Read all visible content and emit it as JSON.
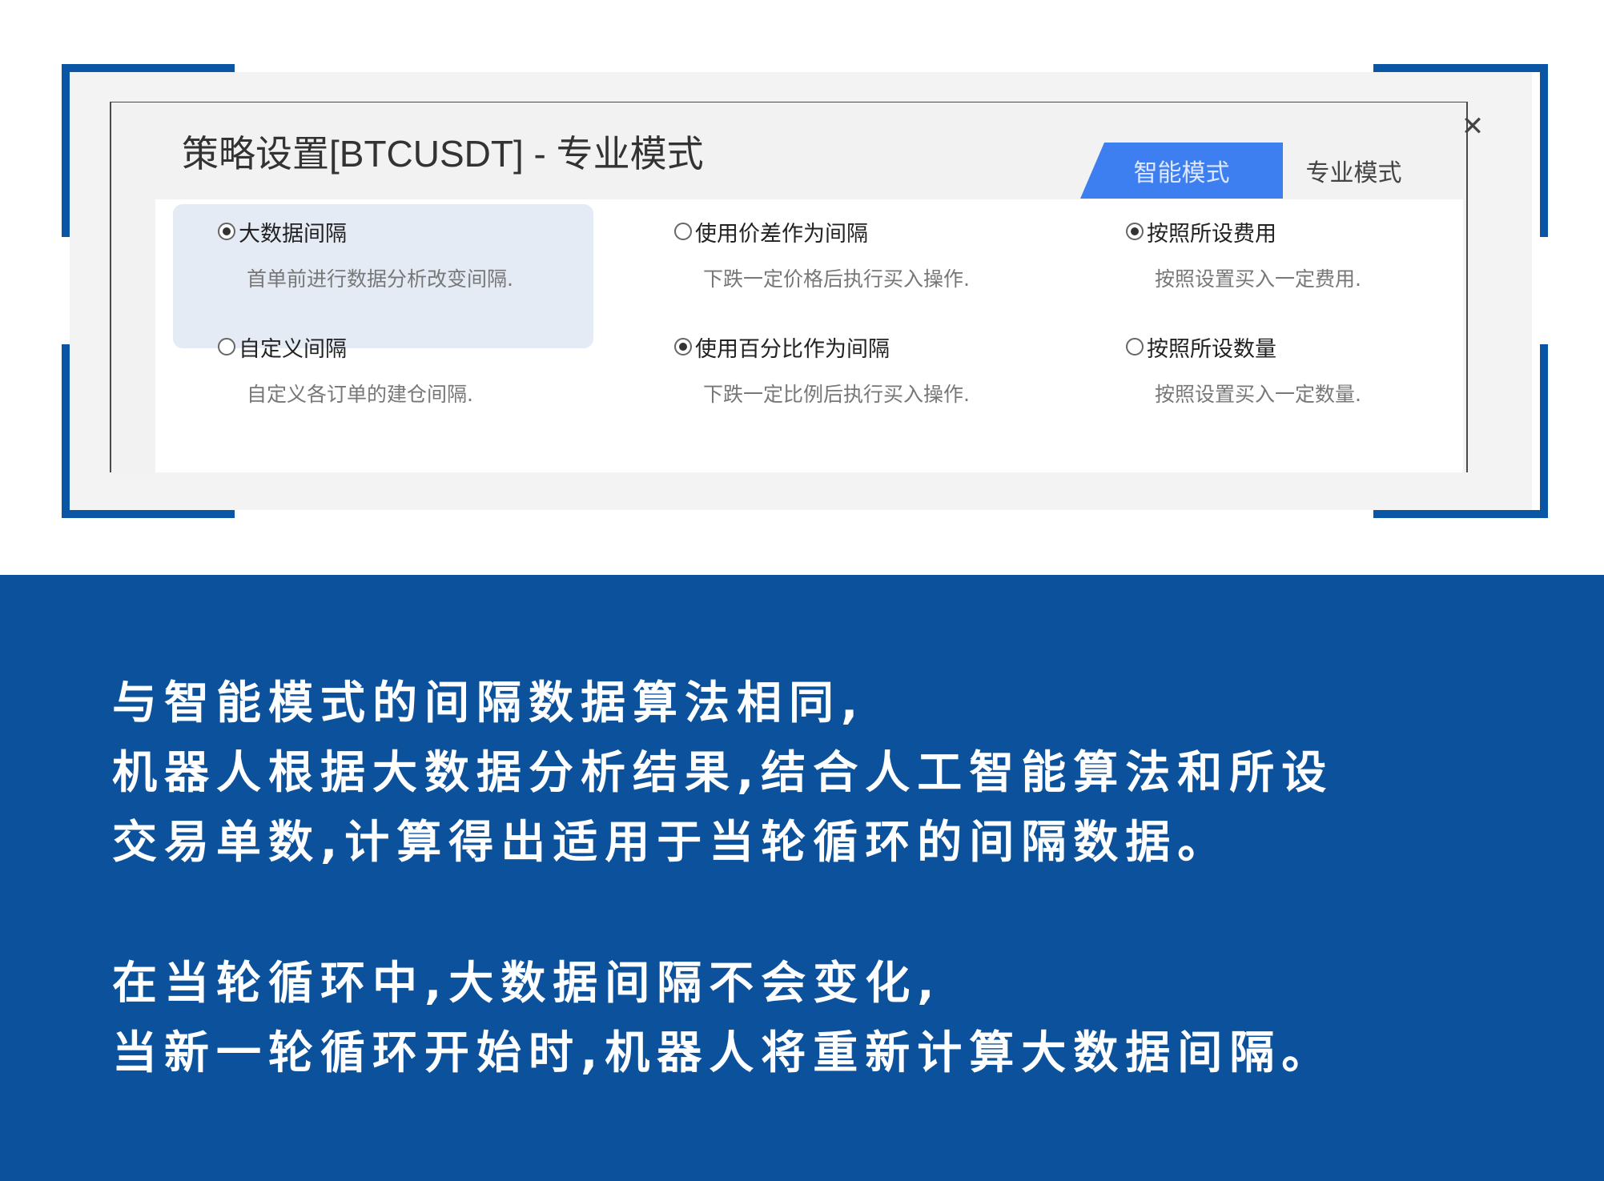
{
  "dialog": {
    "title": "策略设置[BTCUSDT] - 专业模式",
    "close_glyph": "✕",
    "tabs": [
      {
        "label": "智能模式",
        "active": true
      },
      {
        "label": "专业模式",
        "active": false
      }
    ],
    "options": [
      {
        "label": "大数据间隔",
        "description": "首单前进行数据分析改变间隔.",
        "checked": true,
        "highlighted": true
      },
      {
        "label": "使用价差作为间隔",
        "description": "下跌一定价格后执行买入操作.",
        "checked": false
      },
      {
        "label": "按照所设费用",
        "description": "按照设置买入一定费用.",
        "checked": true
      },
      {
        "label": "自定义间隔",
        "description": "自定义各订单的建仓间隔.",
        "checked": false
      },
      {
        "label": "使用百分比作为间隔",
        "description": "下跌一定比例后执行买入操作.",
        "checked": true
      },
      {
        "label": "按照所设数量",
        "description": "按照设置买入一定数量.",
        "checked": false
      }
    ]
  },
  "info": {
    "paragraph1": [
      "与智能模式的间隔数据算法相同,",
      "机器人根据大数据分析结果,结合人工智能算法和所设",
      "交易单数,计算得出适用于当轮循环的间隔数据。"
    ],
    "paragraph2": [
      "在当轮循环中,大数据间隔不会变化,",
      "当新一轮循环开始时,机器人将重新计算大数据间隔。"
    ]
  },
  "colors": {
    "accent_blue": "#0b519c",
    "tab_active": "#3d7ef0",
    "highlight": "#e4ebf4"
  }
}
